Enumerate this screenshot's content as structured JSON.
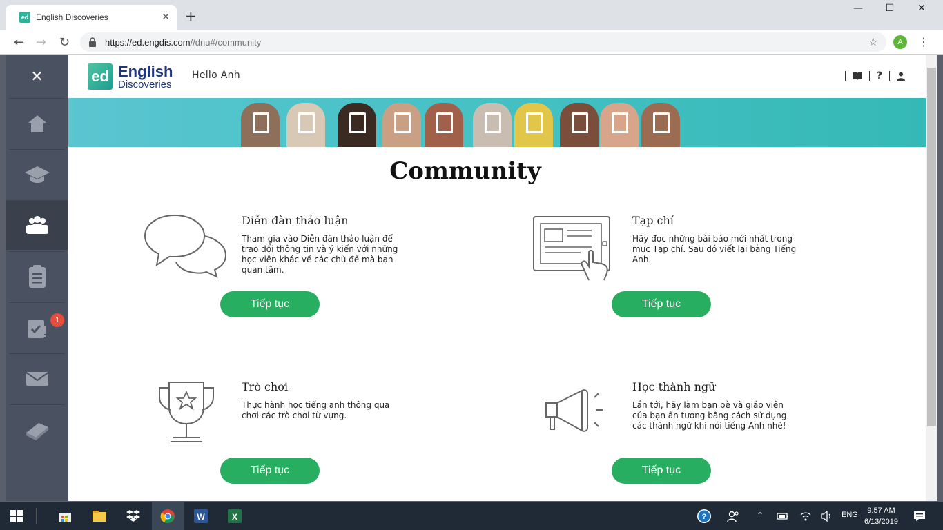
{
  "browser": {
    "tab_title": "English Discoveries",
    "tab_favicon": "ed",
    "url_host": "https://ed.engdis.com",
    "url_path": "//dnu#/community",
    "profile_initial": "A"
  },
  "sidebar": {
    "items": [
      {
        "name": "home-icon"
      },
      {
        "name": "graduation-cap-icon"
      },
      {
        "name": "community-icon",
        "active": true
      },
      {
        "name": "clipboard-icon"
      },
      {
        "name": "assignments-icon",
        "badge": "1"
      },
      {
        "name": "mail-icon"
      },
      {
        "name": "book-icon"
      }
    ]
  },
  "header": {
    "logo_mark": "ed",
    "logo_line1": "English",
    "logo_line2": "Discoveries",
    "greeting": "Hello Anh"
  },
  "page": {
    "title": "Community",
    "cards": [
      {
        "title": "Diễn đàn thảo luận",
        "desc": "Tham gia vào Diễn đàn thảo luận để trao đổi thông tin và ý kiến với những học viên khác về các chủ đề mà bạn quan tâm.",
        "button": "Tiếp tục",
        "icon": "speech-bubbles-icon"
      },
      {
        "title": "Tạp chí",
        "desc": "Hãy đọc những bài báo mới nhất trong mục Tạp chí. Sau đó viết lại bằng Tiếng Anh.",
        "button": "Tiếp tục",
        "icon": "tablet-article-icon"
      },
      {
        "title": "Trò chơi",
        "desc": "Thực hành học tiếng anh thông qua chơi các trò chơi từ vựng.",
        "button": "Tiếp tục",
        "icon": "trophy-icon"
      },
      {
        "title": "Học thành ngữ",
        "desc": "Lần tới, hãy làm bạn bè và giáo viên của bạn ấn tượng bằng cách sử dụng các thành ngữ khi nói tiếng Anh nhé!",
        "button": "Tiếp tục",
        "icon": "megaphone-icon"
      }
    ]
  },
  "taskbar": {
    "lang": "ENG",
    "time": "9:57 AM",
    "date": "6/13/2019"
  },
  "colors": {
    "accent_green": "#27ae60",
    "sidebar": "#4a5160",
    "banner_teal": "#3dbdb9",
    "brand_navy": "#20387a"
  }
}
